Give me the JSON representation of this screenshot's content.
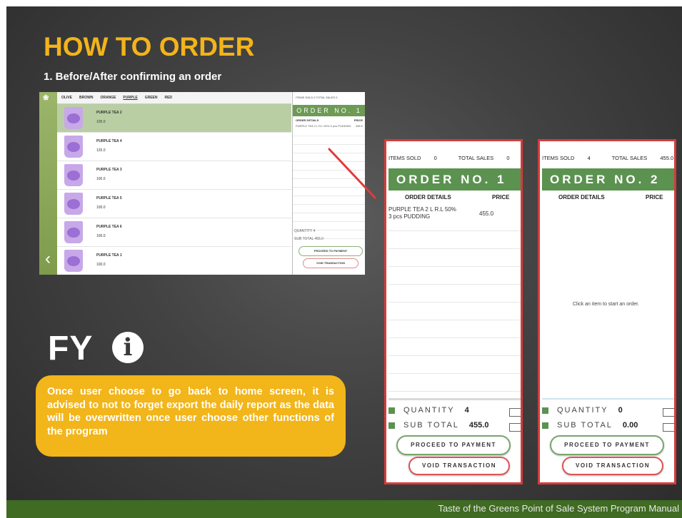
{
  "slide": {
    "title": "HOW TO ORDER",
    "subtitle": "1. Before/After confirming an order",
    "footer": "Taste of the Greens Point of Sale System Program Manual",
    "fyi_label": "FY",
    "note": "Once user choose to go back to home screen, it is advised to not to forget export the daily report as the data will be overwritten once user choose other functions of the program"
  },
  "mini": {
    "tabs": [
      "OLIVE",
      "BROWN",
      "ORANGE",
      "PURPLE",
      "GREEN",
      "RED"
    ],
    "active_tab": "PURPLE",
    "products": [
      {
        "name": "PURPLE TEA 2",
        "price": "105.0"
      },
      {
        "name": "PURPLE TEA 4",
        "price": "125.0"
      },
      {
        "name": "PURPLE TEA 3",
        "price": "100.0"
      },
      {
        "name": "PURPLE TEA 5",
        "price": "100.0"
      },
      {
        "name": "PURPLE TEA 6",
        "price": "100.0"
      },
      {
        "name": "PURPLE TEA 1",
        "price": "100.0"
      }
    ],
    "stats": "ITEMS SOLD 0    TOTAL SALES 0",
    "order_title": "ORDER NO. 1",
    "hdr_details": "ORDER DETAILS",
    "hdr_price": "PRICE",
    "item": "PURPLE TEA 2 L R.L 50% 3 pcs PUDDING",
    "item_price": "455.0",
    "quantity": "QUANTITY",
    "quantity_value": "4",
    "subtotal": "SUB TOTAL",
    "subtotal_value": "455.0",
    "proceed": "PROCEED TO PAYMENT",
    "void": "VOID TRANSACTION"
  },
  "panel1": {
    "items_sold_label": "ITEMS SOLD",
    "items_sold": "0",
    "total_sales_label": "TOTAL SALES",
    "total_sales": "0",
    "order_title": "ORDER NO. 1",
    "hdr_details": "ORDER DETAILS",
    "hdr_price": "PRICE",
    "item_line1": "PURPLE TEA 2 L R.L 50%",
    "item_line2": "3 pcs PUDDING",
    "item_price": "455.0",
    "quantity_label": "QUANTITY",
    "quantity": "4",
    "subtotal_label": "SUB TOTAL",
    "subtotal": "455.0",
    "proceed": "PROCEED TO PAYMENT",
    "void": "VOID TRANSACTION"
  },
  "panel2": {
    "items_sold_label": "ITEMS SOLD",
    "items_sold": "4",
    "total_sales_label": "TOTAL SALES",
    "total_sales": "455.0",
    "order_title": "ORDER NO. 2",
    "hdr_details": "ORDER DETAILS",
    "hdr_price": "PRICE",
    "empty_message": "Click an item to start an order.",
    "quantity_label": "QUANTITY",
    "quantity": "0",
    "subtotal_label": "SUB TOTAL",
    "subtotal": "0.00",
    "proceed": "PROCEED TO PAYMENT",
    "void": "VOID TRANSACTION"
  },
  "colors": {
    "title": "#f2b41a",
    "accent_green": "#5b9250",
    "highlight_red": "#d43c3c",
    "note_bg": "#f2b51a",
    "footer_bg": "#3f6b22"
  },
  "icons": {
    "fyi": "info-circle-icon",
    "back": "chevron-left-icon"
  }
}
